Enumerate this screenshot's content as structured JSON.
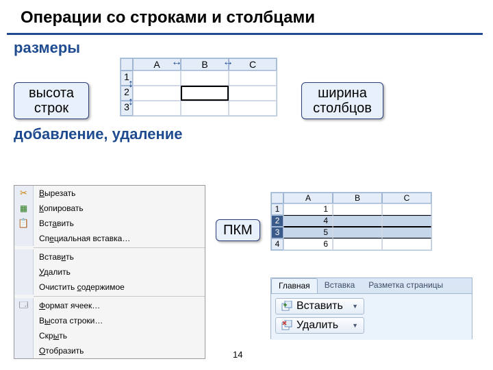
{
  "title": "Операции со строками и столбцами",
  "sizes_heading": "размеры",
  "row_height_label": "высота\nстрок",
  "col_width_label": "ширина\nстолбцов",
  "adddel_heading": "добавление, удаление",
  "rclick_label": "ПКМ",
  "sheet1": {
    "cols": [
      "A",
      "B",
      "C"
    ],
    "rows": [
      "1",
      "2",
      "3"
    ]
  },
  "context_menu": {
    "items": [
      {
        "icon": "scissors-icon",
        "label_pre": "",
        "mnk": "В",
        "label_post": "ырезать"
      },
      {
        "icon": "doc-icon",
        "label_pre": "",
        "mnk": "К",
        "label_post": "опировать"
      },
      {
        "icon": "clipboard-icon",
        "label_pre": "Вст",
        "mnk": "а",
        "label_post": "вить"
      },
      {
        "icon": "",
        "label_pre": "Сп",
        "mnk": "е",
        "label_post": "циальная вставка…"
      },
      {
        "icon": "",
        "label_pre": "Встав",
        "mnk": "и",
        "label_post": "ть"
      },
      {
        "icon": "",
        "label_pre": "",
        "mnk": "У",
        "label_post": "далить"
      },
      {
        "icon": "",
        "label_pre": "Очистить ",
        "mnk": "с",
        "label_post": "одержимое"
      },
      {
        "icon": "format-icon",
        "label_pre": "",
        "mnk": "Ф",
        "label_post": "ормат ячеек…"
      },
      {
        "icon": "",
        "label_pre": "В",
        "mnk": "ы",
        "label_post": "сота строки…"
      },
      {
        "icon": "",
        "label_pre": "Скр",
        "mnk": "ы",
        "label_post": "ть"
      },
      {
        "icon": "",
        "label_pre": "",
        "mnk": "О",
        "label_post": "тобразить"
      }
    ],
    "separators_after": [
      3,
      6
    ]
  },
  "sheet2": {
    "cols": [
      "A",
      "B",
      "C"
    ],
    "rows": [
      {
        "h": "1",
        "cells": [
          "1",
          "",
          ""
        ]
      },
      {
        "h": "2",
        "cells": [
          "4",
          "",
          ""
        ],
        "selected": true
      },
      {
        "h": "3",
        "cells": [
          "5",
          "",
          ""
        ],
        "selected": true
      },
      {
        "h": "4",
        "cells": [
          "6",
          "",
          ""
        ]
      }
    ]
  },
  "ribbon": {
    "tabs": [
      "Главная",
      "Вставка",
      "Разметка страницы"
    ],
    "active_tab": 0,
    "insert_label": "Вставить",
    "delete_label": "Удалить"
  },
  "page_number": "14"
}
